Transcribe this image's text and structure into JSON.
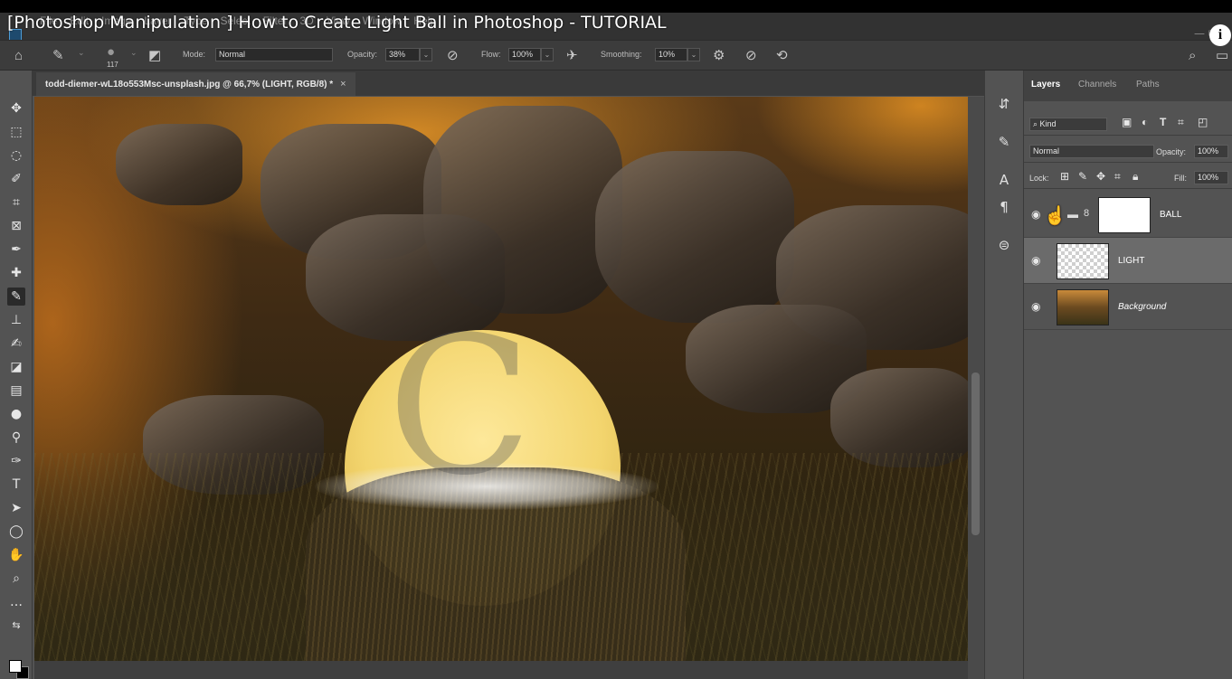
{
  "video": {
    "title": "[Photoshop Manipulation ] How to Create Light Ball in Photoshop - TUTORIAL",
    "info_icon": "info-icon"
  },
  "menu": {
    "items": [
      "File",
      "Edit",
      "Image",
      "Layer",
      "Type",
      "Select",
      "Filter",
      "3D",
      "View",
      "Window",
      "Help"
    ]
  },
  "options": {
    "brush_size": "117",
    "mode_label": "Mode:",
    "mode_value": "Normal",
    "opacity_label": "Opacity:",
    "opacity_value": "38%",
    "flow_label": "Flow:",
    "flow_value": "100%",
    "smoothing_label": "Smoothing:",
    "smoothing_value": "10%"
  },
  "document": {
    "tab_title": "todd-diemer-wL18o553Msc-unsplash.jpg @ 66,7% (LIGHT, RGB/8) *",
    "close": "×"
  },
  "layers_panel": {
    "tabs": [
      "Layers",
      "Channels",
      "Paths"
    ],
    "active_tab": "Layers",
    "filter_label": "Kind",
    "blend_mode": "Normal",
    "opacity_label": "Opacity:",
    "opacity_value": "100%",
    "lock_label": "Lock:",
    "fill_label": "Fill:",
    "fill_value": "100%",
    "layers": [
      {
        "name": "BALL",
        "type": "group",
        "selected": false
      },
      {
        "name": "LIGHT",
        "type": "pixel",
        "selected": true
      },
      {
        "name": "Background",
        "type": "background",
        "selected": false
      }
    ]
  },
  "colors": {
    "ui_bg": "#535353",
    "menubar": "#323232",
    "ball": "#f3d56e",
    "selected_layer": "#6b6b6b"
  }
}
